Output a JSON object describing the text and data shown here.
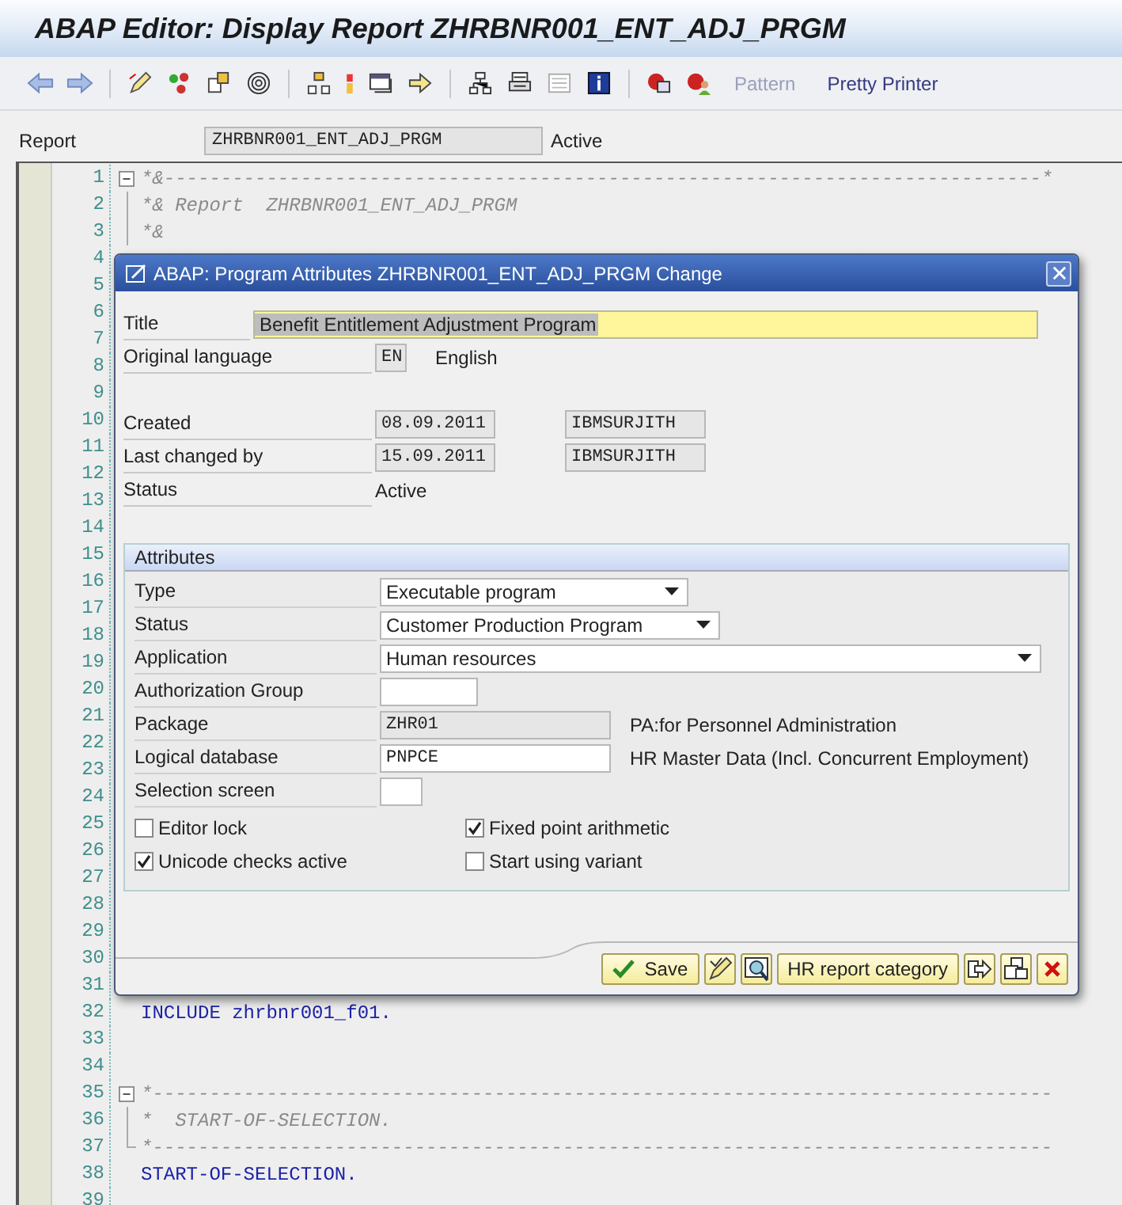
{
  "window": {
    "title": "ABAP Editor: Display Report ZHRBNR001_ENT_ADJ_PRGM"
  },
  "toolbar": {
    "buttons": [
      {
        "label": "Pattern",
        "disabled": true
      },
      {
        "label": "Pretty Printer",
        "disabled": false
      }
    ]
  },
  "report": {
    "label": "Report",
    "value": "ZHRBNR001_ENT_ADJ_PRGM",
    "status": "Active"
  },
  "editor": {
    "lines": [
      {
        "number": "1",
        "kind": "comment",
        "fold": {
          "kind": "start"
        },
        "text": "*&-----------------------------------------------------------------------------*"
      },
      {
        "number": "2",
        "kind": "comment",
        "fold": {
          "kind": "inner"
        },
        "text": "*& Report  ZHRBNR001_ENT_ADJ_PRGM"
      },
      {
        "number": "3",
        "kind": "comment",
        "fold": {
          "kind": "inner"
        },
        "text": "*&"
      },
      {
        "number": "4"
      },
      {
        "number": "5"
      },
      {
        "number": "6"
      },
      {
        "number": "7"
      },
      {
        "number": "8"
      },
      {
        "number": "9"
      },
      {
        "number": "10"
      },
      {
        "number": "11"
      },
      {
        "number": "12"
      },
      {
        "number": "13"
      },
      {
        "number": "14"
      },
      {
        "number": "15"
      },
      {
        "number": "16"
      },
      {
        "number": "17"
      },
      {
        "number": "18"
      },
      {
        "number": "19"
      },
      {
        "number": "20"
      },
      {
        "number": "21"
      },
      {
        "number": "22"
      },
      {
        "number": "23"
      },
      {
        "number": "24"
      },
      {
        "number": "25"
      },
      {
        "number": "26"
      },
      {
        "number": "27"
      },
      {
        "number": "28"
      },
      {
        "number": "29"
      },
      {
        "number": "30"
      },
      {
        "number": "31"
      },
      {
        "number": "32",
        "kind": "keyword",
        "text": "INCLUDE zhrbnr001_f01."
      },
      {
        "number": "33"
      },
      {
        "number": "34"
      },
      {
        "number": "35",
        "kind": "comment",
        "fold": {
          "kind": "start"
        },
        "text": "*-------------------------------------------------------------------------------"
      },
      {
        "number": "36",
        "kind": "comment",
        "fold": {
          "kind": "inner"
        },
        "text": "*  START-OF-SELECTION."
      },
      {
        "number": "37",
        "kind": "comment",
        "fold": {
          "kind": "end"
        },
        "text": "*-------------------------------------------------------------------------------"
      },
      {
        "number": "38",
        "kind": "keyword",
        "text": "START-OF-SELECTION."
      },
      {
        "number": "39"
      }
    ]
  },
  "dialog": {
    "title": "ABAP: Program Attributes ZHRBNR001_ENT_ADJ_PRGM Change",
    "title_field": {
      "label": "Title",
      "value": "Benefit Entitlement Adjustment Program"
    },
    "language": {
      "label": "Original language",
      "code": "EN",
      "name": "English"
    },
    "created": {
      "label": "Created",
      "date": "08.09.2011",
      "user": "IBMSURJITH"
    },
    "changed": {
      "label": "Last changed by",
      "date": "15.09.2011",
      "user": "IBMSURJITH"
    },
    "status": {
      "label": "Status",
      "value": "Active"
    },
    "attributes": {
      "title": "Attributes",
      "fields": [
        {
          "kind": "dropdown",
          "label": "Type",
          "value": "Executable program"
        },
        {
          "kind": "dropdown",
          "label": "Status",
          "value": "Customer Production Program"
        },
        {
          "kind": "dropdown",
          "label": "Application",
          "value": "Human resources"
        },
        {
          "kind": "input",
          "label": "Authorization Group"
        },
        {
          "kind": "readonly",
          "label": "Package",
          "value": "ZHR01",
          "description": "PA:for Personnel Administration"
        },
        {
          "kind": "input",
          "label": "Logical database",
          "value": "PNPCE",
          "description": "HR Master Data (Incl. Concurrent Employment)"
        },
        {
          "kind": "input",
          "label": "Selection screen"
        }
      ],
      "checkboxes": [
        {
          "label": "Editor lock",
          "checked": false
        },
        {
          "label": "Fixed point arithmetic",
          "checked": true
        },
        {
          "label": "Unicode checks active",
          "checked": true
        },
        {
          "label": "Start using variant",
          "checked": false
        }
      ]
    },
    "buttons": [
      {
        "kind": "save",
        "label": "Save"
      },
      {
        "kind": "icon"
      },
      {
        "kind": "icon"
      },
      {
        "kind": "text",
        "label": "HR report category"
      },
      {
        "kind": "icon"
      },
      {
        "kind": "icon"
      },
      {
        "kind": "cancel"
      }
    ]
  }
}
